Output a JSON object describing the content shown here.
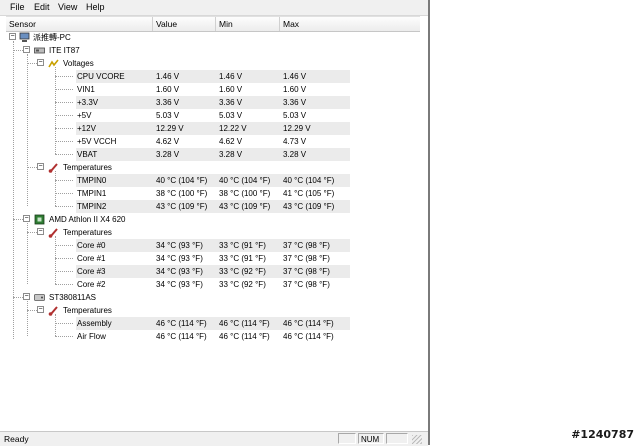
{
  "menu": [
    "File",
    "Edit",
    "View",
    "Help"
  ],
  "columns": [
    "Sensor",
    "Value",
    "Min",
    "Max"
  ],
  "computer": "派推轉-PC",
  "devices": [
    {
      "name": "ITE IT87",
      "groups": [
        {
          "name": "Voltages",
          "sensors": [
            {
              "name": "CPU VCORE",
              "value": "1.46 V",
              "min": "1.46 V",
              "max": "1.46 V"
            },
            {
              "name": "VIN1",
              "value": "1.60 V",
              "min": "1.60 V",
              "max": "1.60 V"
            },
            {
              "name": "+3.3V",
              "value": "3.36 V",
              "min": "3.36 V",
              "max": "3.36 V"
            },
            {
              "name": "+5V",
              "value": "5.03 V",
              "min": "5.03 V",
              "max": "5.03 V"
            },
            {
              "name": "+12V",
              "value": "12.29 V",
              "min": "12.22 V",
              "max": "12.29 V"
            },
            {
              "name": "+5V VCCH",
              "value": "4.62 V",
              "min": "4.62 V",
              "max": "4.73 V"
            },
            {
              "name": "VBAT",
              "value": "3.28 V",
              "min": "3.28 V",
              "max": "3.28 V"
            }
          ]
        },
        {
          "name": "Temperatures",
          "sensors": [
            {
              "name": "TMPIN0",
              "value": "40 °C  (104 °F)",
              "min": "40 °C  (104 °F)",
              "max": "40 °C  (104 °F)"
            },
            {
              "name": "TMPIN1",
              "value": "38 °C  (100 °F)",
              "min": "38 °C  (100 °F)",
              "max": "41 °C  (105 °F)"
            },
            {
              "name": "TMPIN2",
              "value": "43 °C  (109 °F)",
              "min": "43 °C  (109 °F)",
              "max": "43 °C  (109 °F)"
            }
          ]
        }
      ]
    },
    {
      "name": "AMD Athlon II X4 620",
      "groups": [
        {
          "name": "Temperatures",
          "sensors": [
            {
              "name": "Core #0",
              "value": "34 °C  (93 °F)",
              "min": "33 °C  (91 °F)",
              "max": "37 °C  (98 °F)"
            },
            {
              "name": "Core #1",
              "value": "34 °C  (93 °F)",
              "min": "33 °C  (91 °F)",
              "max": "37 °C  (98 °F)"
            },
            {
              "name": "Core #3",
              "value": "34 °C  (93 °F)",
              "min": "33 °C  (92 °F)",
              "max": "37 °C  (98 °F)"
            },
            {
              "name": "Core #2",
              "value": "34 °C  (93 °F)",
              "min": "33 °C  (92 °F)",
              "max": "37 °C  (98 °F)"
            }
          ]
        }
      ]
    },
    {
      "name": "ST380811AS",
      "groups": [
        {
          "name": "Temperatures",
          "sensors": [
            {
              "name": "Assembly",
              "value": "46 °C  (114 °F)",
              "min": "46 °C  (114 °F)",
              "max": "46 °C  (114 °F)"
            },
            {
              "name": "Air Flow",
              "value": "46 °C  (114 °F)",
              "min": "46 °C  (114 °F)",
              "max": "46 °C  (114 °F)"
            }
          ]
        }
      ]
    }
  ],
  "status": {
    "text": "Ready",
    "num": "NUM"
  },
  "watermark": "#1240787",
  "colors": {
    "voltage_icon": "#c8a000",
    "temperature_icon": "#b03030",
    "chip_icon": "#2e7d32"
  }
}
